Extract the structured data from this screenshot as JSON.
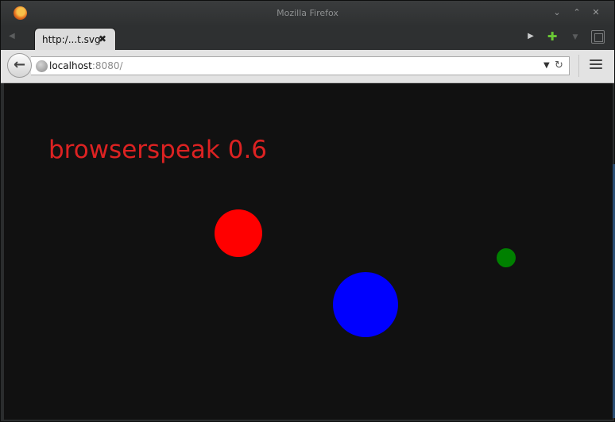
{
  "window": {
    "title": "Mozilla Firefox"
  },
  "tab": {
    "label": "http:/...t.svg",
    "close_glyph": "✖"
  },
  "urlbar": {
    "host": "localhost",
    "rest": ":8080/"
  },
  "page": {
    "heading": "browserspeak 0.6",
    "colors": {
      "heading": "#dd2222",
      "background": "#111111"
    },
    "circles": [
      {
        "name": "red-circle",
        "color": "#ff0000"
      },
      {
        "name": "blue-circle",
        "color": "#0000ff"
      },
      {
        "name": "green-circle",
        "color": "#008000"
      }
    ]
  }
}
